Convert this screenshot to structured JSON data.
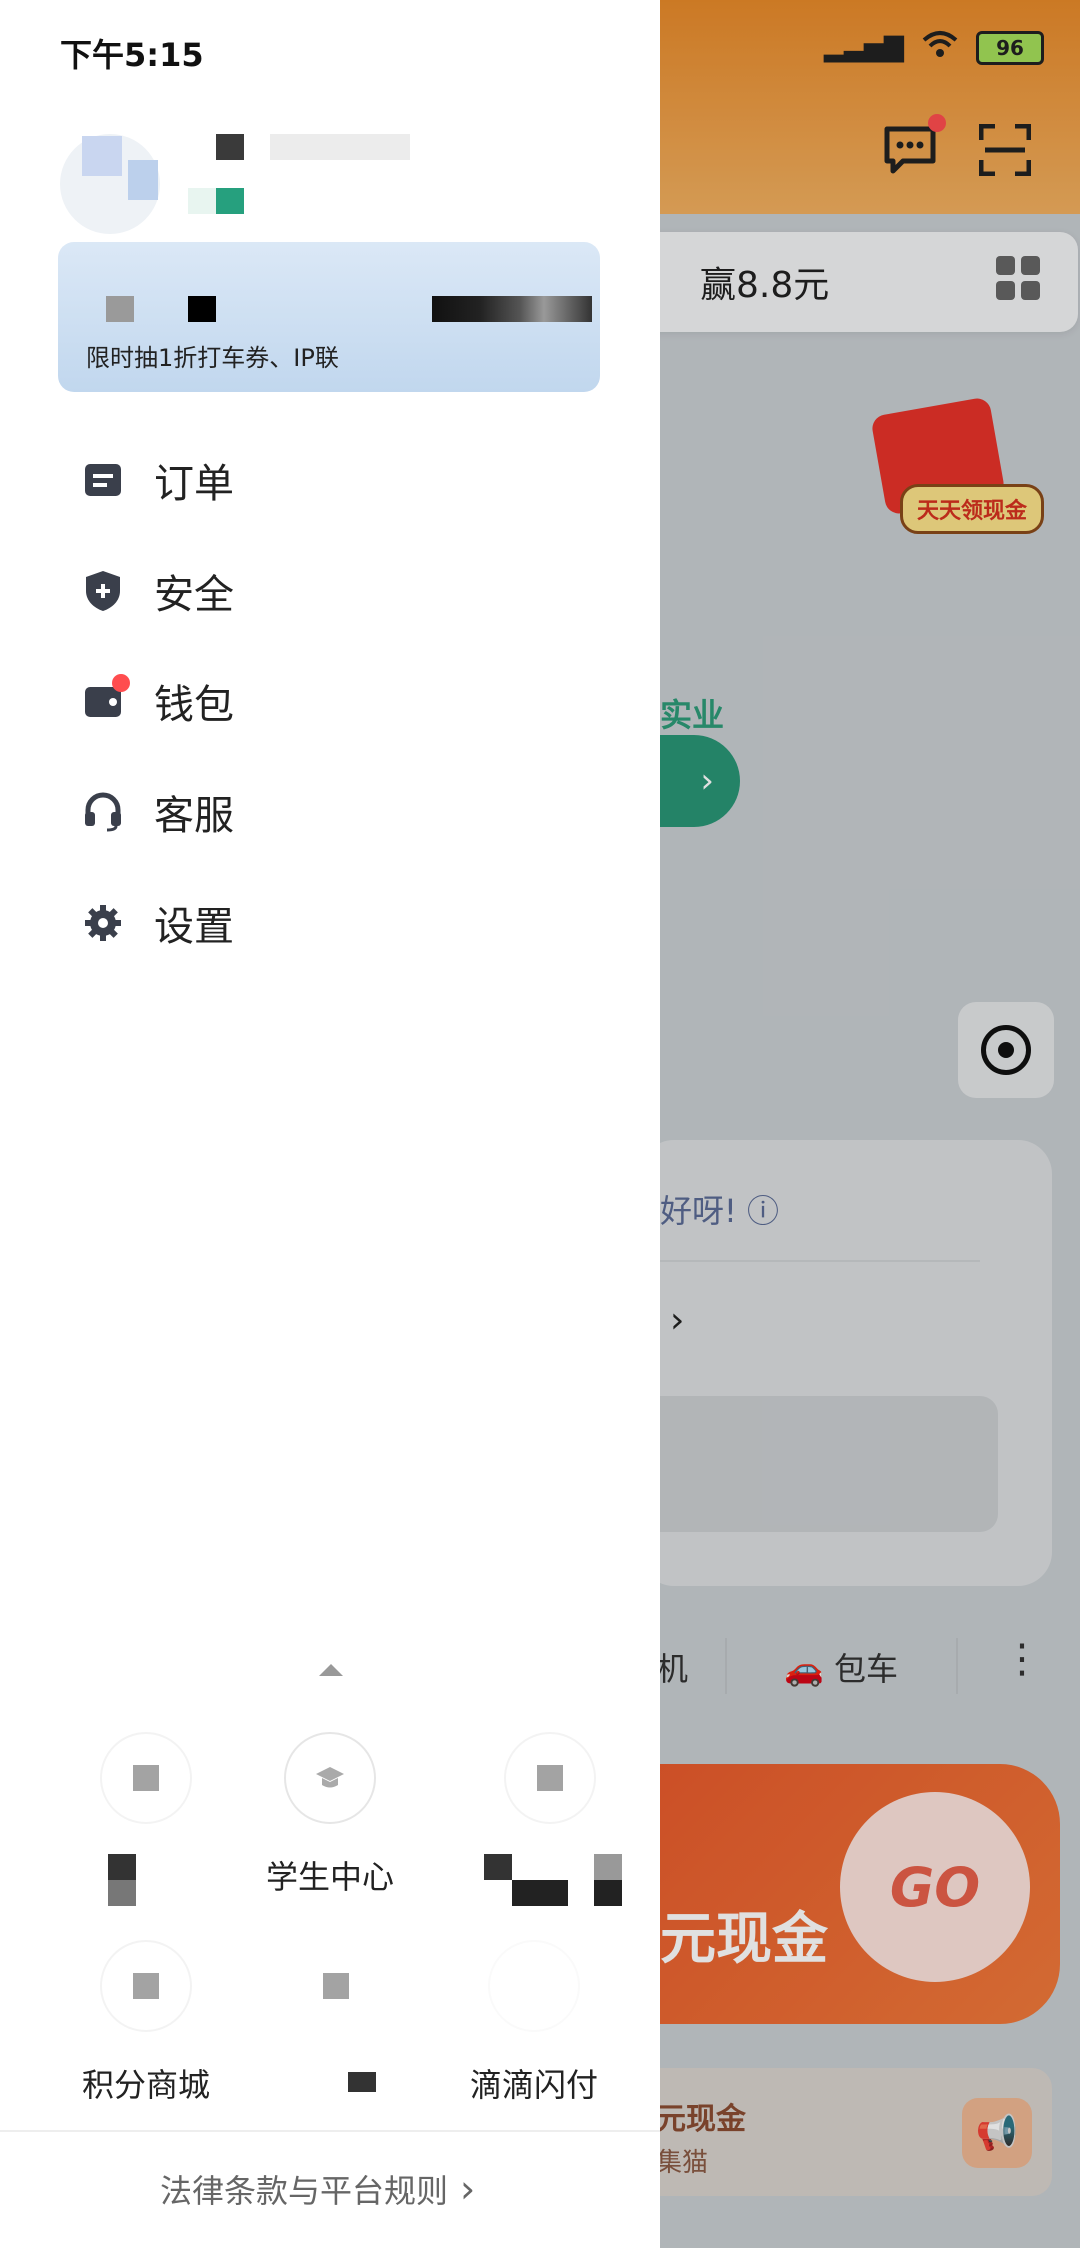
{
  "status_bar": {
    "time": "下午5:15",
    "battery": "96"
  },
  "background_app": {
    "search_text": "赢8.8元",
    "redpacket_label": "天天领现金",
    "promo_green": "实业有",
    "greeting": "好呀!",
    "tab_bus": "包车",
    "tab_partial": "机",
    "banner_text": "元现金",
    "banner_go": "GO",
    "bottom_line1": "元现金",
    "bottom_line2": "集猫"
  },
  "drawer": {
    "vip_sub": "限时抽1折打车券、IP联",
    "menu": [
      {
        "label": "订单",
        "icon": "order-icon"
      },
      {
        "label": "安全",
        "icon": "shield-icon"
      },
      {
        "label": "钱包",
        "icon": "wallet-icon"
      },
      {
        "label": "客服",
        "icon": "headset-icon"
      },
      {
        "label": "设置",
        "icon": "gear-icon"
      }
    ],
    "services": [
      {
        "label": "",
        "icon": "blurred-icon"
      },
      {
        "label": "学生中心",
        "icon": "graduation-cap-icon"
      },
      {
        "label": "",
        "icon": "blurred-icon"
      },
      {
        "label": "积分商城",
        "icon": "blurred-icon"
      },
      {
        "label": "",
        "icon": "blurred-icon"
      },
      {
        "label": "滴滴闪付",
        "icon": "blurred-icon"
      }
    ],
    "legal": "法律条款与平台规则"
  },
  "colors": {
    "accent_green": "#2a9676",
    "notify_red": "#ff4d4f",
    "header_orange": "#e88a2a"
  }
}
